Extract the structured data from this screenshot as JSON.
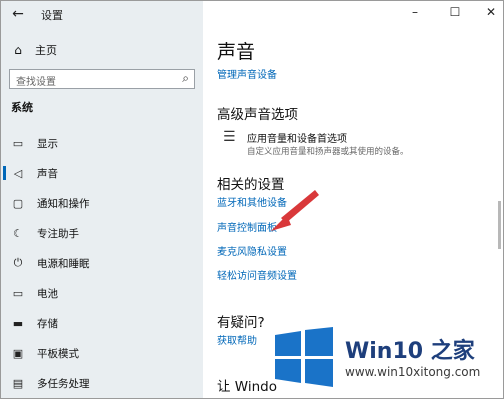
{
  "window": {
    "title": "设置",
    "back_glyph": "←",
    "min_glyph": "–",
    "max_glyph": "☐",
    "close_glyph": "✕"
  },
  "sidebar": {
    "home": {
      "label": "主页",
      "icon": "⌂"
    },
    "search": {
      "placeholder": "查找设置",
      "icon": "⌕"
    },
    "section": "系统",
    "items": [
      {
        "label": "显示",
        "icon": "▭"
      },
      {
        "label": "声音",
        "icon": "◁",
        "active": true
      },
      {
        "label": "通知和操作",
        "icon": "▢"
      },
      {
        "label": "专注助手",
        "icon": "☾"
      },
      {
        "label": "电源和睡眠",
        "icon": "⏻"
      },
      {
        "label": "电池",
        "icon": "▭"
      },
      {
        "label": "存储",
        "icon": "▬"
      },
      {
        "label": "平板模式",
        "icon": "▣"
      },
      {
        "label": "多任务处理",
        "icon": "▤"
      }
    ]
  },
  "main": {
    "title": "声音",
    "manage_link": "管理声音设备",
    "advanced_heading": "高级声音选项",
    "advanced_item_title": "应用音量和设备首选项",
    "advanced_item_desc": "自定义应用音量和扬声器或其使用的设备。",
    "related_heading": "相关的设置",
    "related_links": [
      "蓝牙和其他设备",
      "声音控制面板",
      "麦克风隐私设置",
      "轻松访问音频设置"
    ],
    "question_heading": "有疑问?",
    "help_link": "获取帮助",
    "bottom_heading": "让 Windo"
  },
  "watermark": {
    "brand": "Win10 之家",
    "url": "www.win10xitong.com"
  },
  "colors": {
    "link": "#0067b8",
    "accent_arrow": "#d9383a",
    "logo_blue": "#1a73c8"
  }
}
